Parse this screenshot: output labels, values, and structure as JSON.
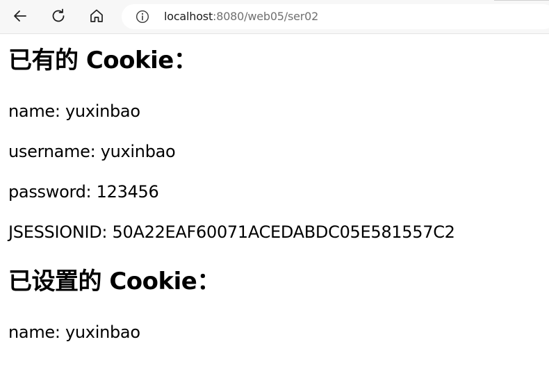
{
  "browser": {
    "url_host": "localhost",
    "url_rest": ":8080/web05/ser02",
    "icons": {
      "back": "arrow-left-icon",
      "reload": "reload-icon",
      "home": "home-icon",
      "info": "info-icon"
    }
  },
  "page": {
    "existing_heading": "已有的 Cookie：",
    "existing_cookies": [
      "name: yuxinbao",
      "username: yuxinbao",
      "password: 123456",
      "JSESSIONID: 50A22EAF60071ACEDABDC05E581557C2"
    ],
    "set_heading": "已设置的 Cookie：",
    "set_cookies": [
      "name: yuxinbao"
    ]
  }
}
